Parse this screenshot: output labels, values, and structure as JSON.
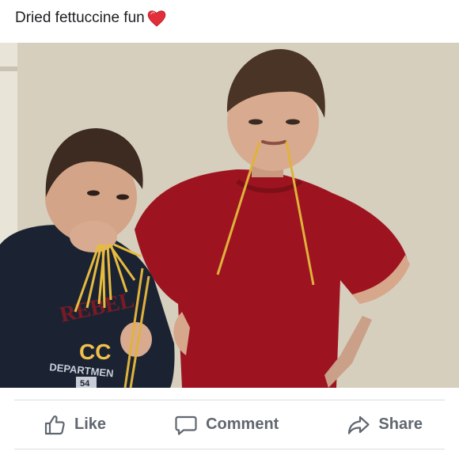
{
  "post": {
    "text": "Dried fettuccine fun",
    "emoji": "heart-emoji"
  },
  "photo": {
    "description_icon": "photo-image"
  },
  "actions": {
    "like_label": "Like",
    "like_icon": "thumbs-up-icon",
    "comment_label": "Comment",
    "comment_icon": "speech-bubble-icon",
    "share_label": "Share",
    "share_icon": "share-arrow-icon"
  },
  "shirt_print": {
    "line1": "REBEL",
    "line2": "CC",
    "line3": "DEPARTMEN",
    "line4": "54"
  },
  "colors": {
    "action_text": "#606770",
    "divider": "#dadde1",
    "heart": "#e0245e"
  }
}
